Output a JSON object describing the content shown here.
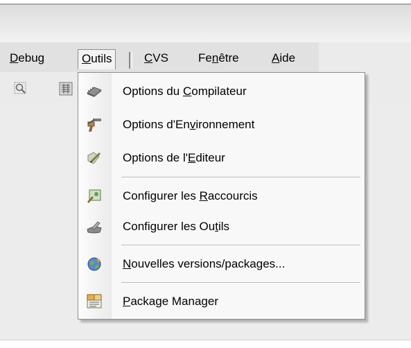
{
  "menubar": {
    "items": [
      {
        "pre": "",
        "u": "D",
        "post": "ebug"
      },
      {
        "pre": "",
        "u": "O",
        "post": "utils"
      },
      {
        "pre": "",
        "u": "C",
        "post": "VS"
      },
      {
        "pre": "Fe",
        "u": "n",
        "post": "être"
      },
      {
        "pre": "",
        "u": "A",
        "post": "ide"
      }
    ]
  },
  "toolbar": {
    "icons": [
      "find-icon",
      "compile-icon"
    ]
  },
  "dropdown": {
    "items": [
      {
        "pre": "Options du ",
        "u": "C",
        "post": "ompilateur",
        "icon": "compiler-chip-icon"
      },
      {
        "pre": "Options d'En",
        "u": "v",
        "post": "ironnement",
        "icon": "environment-icon"
      },
      {
        "pre": "Options de l'",
        "u": "E",
        "post": "diteur",
        "icon": "editor-pencil-icon"
      },
      {
        "pre": "Configurer les ",
        "u": "R",
        "post": "accourcis",
        "icon": "shortcuts-icon"
      },
      {
        "pre": "Configurer les Ou",
        "u": "t",
        "post": "ils",
        "icon": "tools-icon"
      },
      {
        "pre": "",
        "u": "N",
        "post": "ouvelles versions/packages...",
        "icon": "globe-update-icon"
      },
      {
        "pre": "",
        "u": "P",
        "post": "ackage Manager",
        "icon": "package-manager-icon"
      }
    ]
  },
  "colors": {
    "menu_bg": "#f8f8f8",
    "menubar_bg": "#e1e1e1",
    "border": "#8c8c8c"
  }
}
